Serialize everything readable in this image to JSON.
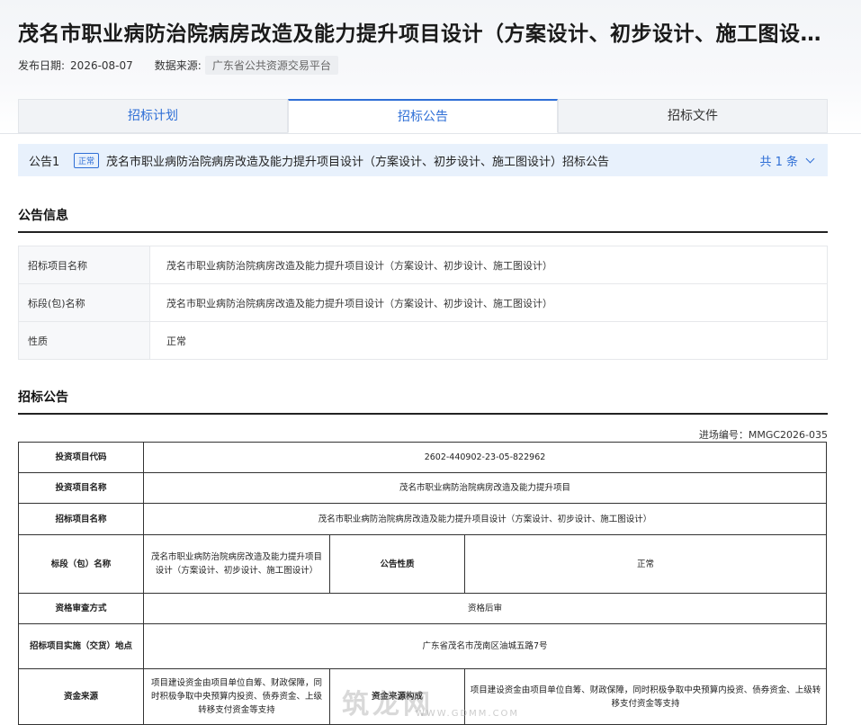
{
  "header": {
    "title": "茂名市职业病防治院病房改造及能力提升项目设计（方案设计、初步设计、施工图设计）",
    "date_label": "发布日期:",
    "date": "2026-08-07",
    "source_label": "数据来源:",
    "source": "广东省公共资源交易平台"
  },
  "tabs": [
    {
      "label": "招标计划"
    },
    {
      "label": "招标公告"
    },
    {
      "label": "招标文件"
    }
  ],
  "notice_bar": {
    "index": "公告1",
    "status": "正常",
    "title": "茂名市职业病防治院病房改造及能力提升项目设计（方案设计、初步设计、施工图设计）招标公告",
    "count": "共 1 条"
  },
  "info_section": {
    "title": "公告信息",
    "rows": [
      {
        "label": "招标项目名称",
        "value": "茂名市职业病防治院病房改造及能力提升项目设计（方案设计、初步设计、施工图设计）"
      },
      {
        "label": "标段(包)名称",
        "value": "茂名市职业病防治院病房改造及能力提升项目设计（方案设计、初步设计、施工图设计）"
      },
      {
        "label": "性质",
        "value": "正常"
      }
    ]
  },
  "announcement": {
    "title": "招标公告",
    "ref_no": "进场编号：MMGC2026-035",
    "investment_code_label": "投资项目代码",
    "investment_code": "2602-440902-23-05-822962",
    "investment_name_label": "投资项目名称",
    "investment_name": "茂名市职业病防治院病房改造及能力提升项目",
    "tender_name_label": "招标项目名称",
    "tender_name": "茂名市职业病防治院病房改造及能力提升项目设计（方案设计、初步设计、施工图设计）",
    "section_label": "标段（包）名称",
    "section_name": "茂名市职业病防治院病房改造及能力提升项目设计（方案设计、初步设计、施工图设计）",
    "nature_label": "公告性质",
    "nature": "正常",
    "qualification_label": "资格审查方式",
    "qualification": "资格后审",
    "location_label": "招标项目实施（交货）地点",
    "location": "广东省茂名市茂南区油城五路7号",
    "fund_label": "资金来源",
    "fund_source": "项目建设资金由项目单位自筹、财政保障，同时积极争取中央预算内投资、债券资金、上级转移支付资金等支持",
    "fund_structure_label": "资金来源构成",
    "fund_structure": "项目建设资金由项目单位自筹、财政保障，同时积极争取中央预算内投资、债券资金、上级转移支付资金等支持"
  },
  "watermark": {
    "text": "筑龙网",
    "sub": "WWW.GDMM.COM"
  }
}
